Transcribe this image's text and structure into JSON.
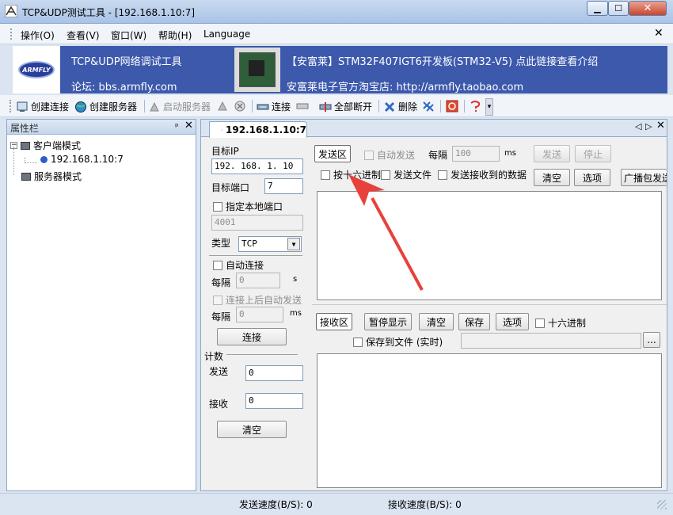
{
  "window": {
    "title": "TCP&UDP测试工具 - [192.168.1.10:7]"
  },
  "menu": {
    "items": [
      "操作(O)",
      "查看(V)",
      "窗口(W)",
      "帮助(H)",
      "Language"
    ]
  },
  "banner": {
    "logo": "ARMFLY",
    "line1": "TCP&UDP网络调试工具",
    "line2": "论坛: bbs.armfly.com",
    "line3": "【安富莱】STM32F407IGT6开发板(STM32-V5) 点此链接查看介绍",
    "line4": "安富莱电子官方淘宝店: http://armfly.taobao.com"
  },
  "toolbar": {
    "create_conn": "创建连接",
    "create_server": "创建服务器",
    "start_server": "启动服务器",
    "connect": "连接",
    "disconnect_all": "全部断开",
    "delete": "删除"
  },
  "sidebar": {
    "title": "属性栏",
    "pin": "ᵖ",
    "client_mode": "客户端模式",
    "connection": "192.168.1.10:7",
    "server_mode": "服务器模式"
  },
  "tab": {
    "label": "192.168.1.10:7"
  },
  "conn": {
    "target_ip_label": "目标IP",
    "target_ip": "192. 168. 1. 10",
    "target_port_label": "目标端口",
    "target_port": "7",
    "local_port_check": "指定本地端口",
    "local_port": "4001",
    "type_label": "类型",
    "type_value": "TCP",
    "auto_connect": "自动连接",
    "interval_label": "每隔",
    "interval_value": "0",
    "interval_unit": "s",
    "auto_send_after": "连接上后自动发送",
    "interval2_label": "每隔",
    "interval2_value": "0",
    "interval2_unit": "ms",
    "connect_btn": "连接"
  },
  "counters": {
    "title": "计数",
    "send_label": "发送",
    "send_value": "0",
    "recv_label": "接收",
    "recv_value": "0",
    "clear_btn": "清空"
  },
  "send": {
    "area_btn": "发送区",
    "auto_send": "自动发送",
    "every_label": "每隔",
    "every_value": "100",
    "every_unit": "ms",
    "send_btn": "发送",
    "stop_btn": "停止",
    "hex_check": "按十六进制",
    "send_file": "发送文件",
    "send_received": "发送接收到的数据",
    "clear_btn": "清空",
    "options_btn": "选项",
    "broadcast_btn": "广播包发送"
  },
  "recv": {
    "area_btn": "接收区",
    "pause_btn": "暂停显示",
    "clear_btn": "清空",
    "save_btn": "保存",
    "options_btn": "选项",
    "hex_check": "十六进制",
    "save_to_file": "保存到文件 (实时)",
    "browse": "..."
  },
  "status": {
    "send_speed": "发送速度(B/S): 0",
    "recv_speed": "接收速度(B/S): 0"
  },
  "colors": {
    "banner": "#3d59ac",
    "arrow": "#e8413c"
  }
}
